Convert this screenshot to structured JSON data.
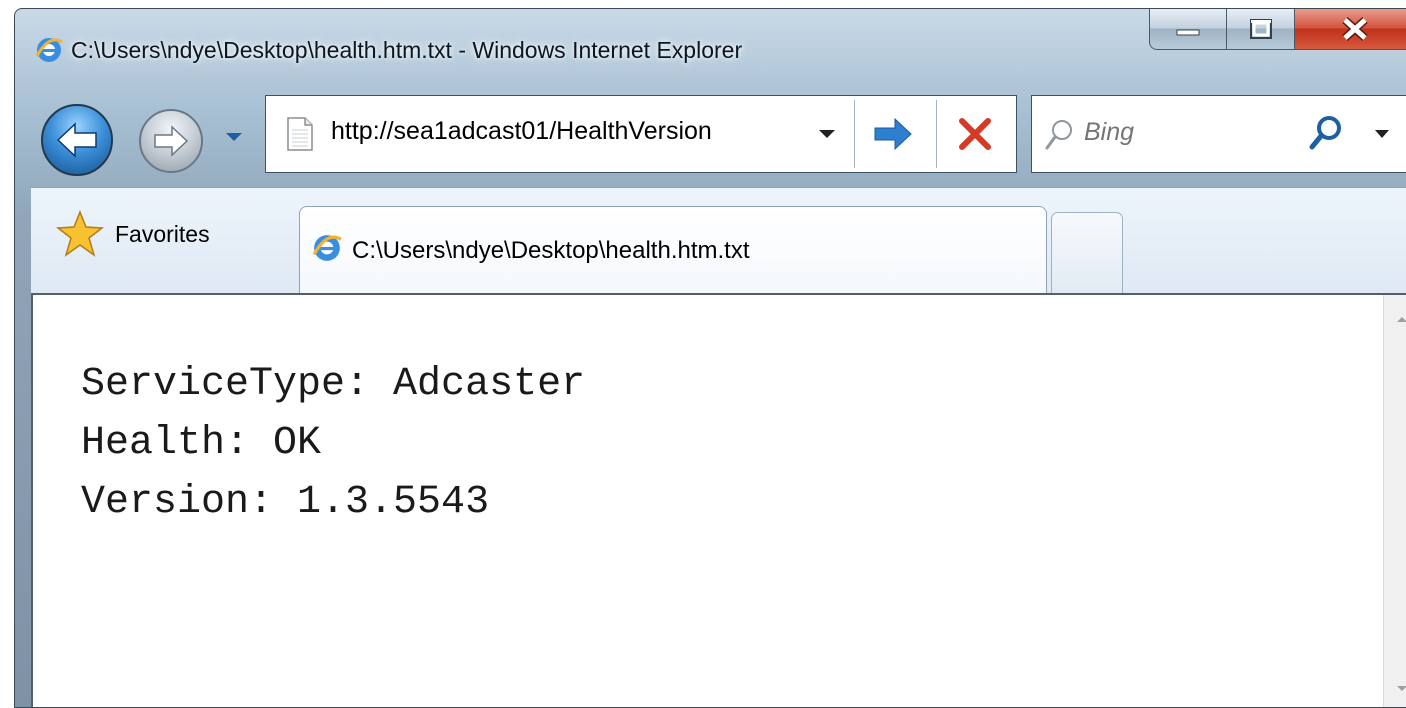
{
  "window": {
    "title": "C:\\Users\\ndye\\Desktop\\health.htm.txt - Windows Internet Explorer",
    "controls": [
      "minimize-icon",
      "maximize-icon",
      "close-icon"
    ]
  },
  "navigation": {
    "address": "http://sea1adcast01/HealthVersion",
    "search_placeholder": "Bing"
  },
  "favorites_bar": {
    "favorites_label": "Favorites"
  },
  "tabs": [
    {
      "label": "C:\\Users\\ndye\\Desktop\\health.htm.txt",
      "active": true
    }
  ],
  "document": {
    "lines": [
      "ServiceType: Adcaster",
      "Health: OK",
      "Version: 1.3.5543"
    ]
  },
  "colors": {
    "frame_top": "#c9d9e6",
    "frame_bottom": "#7c93a6",
    "back_button": "#3c8fd9",
    "go_arrow": "#2f7fd0",
    "stop_x": "#d43a26",
    "close_button": "#c0311b",
    "tab_bar": "#e6eef7"
  }
}
